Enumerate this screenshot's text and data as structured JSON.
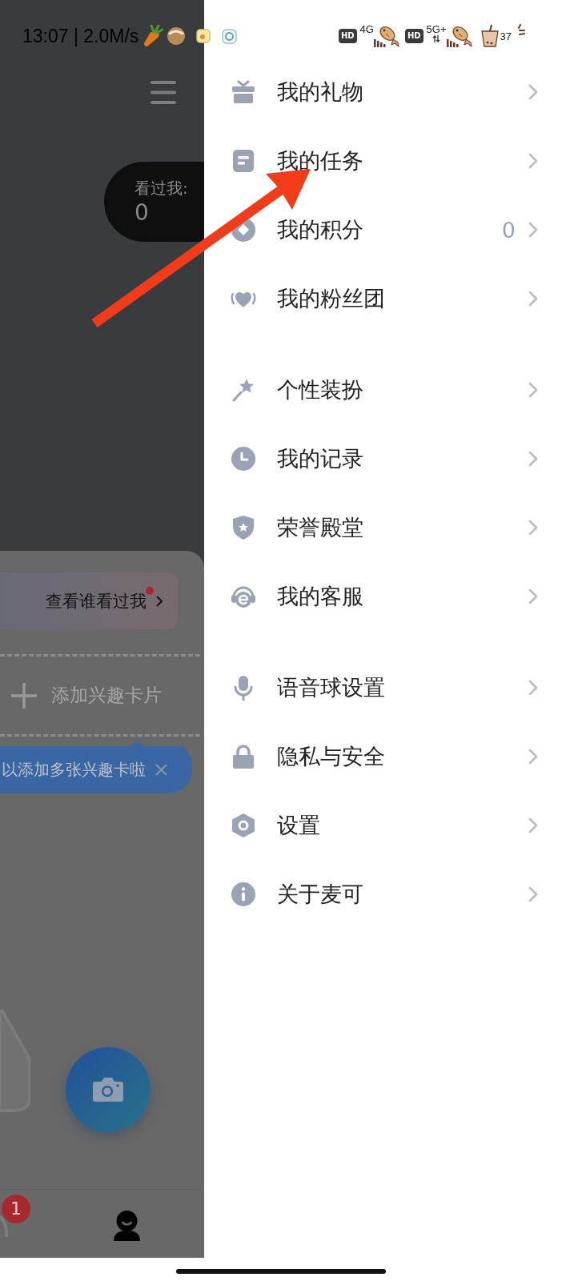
{
  "status_bar": {
    "time": "13:07 | 2.0M/s",
    "networks": [
      {
        "badge": "HD",
        "type": "4G",
        "data_arrows": false
      },
      {
        "badge": "HD",
        "type": "5G+",
        "data_arrows": true
      }
    ],
    "battery": "37"
  },
  "background_page": {
    "visitors": {
      "label": "看过我:",
      "count": "0"
    },
    "visitors_button": {
      "label": "查看谁看过我",
      "unread": true
    },
    "add_card": {
      "label": "添加兴趣卡片"
    },
    "tip": {
      "text": "以添加多张兴趣卡啦"
    },
    "bottom_nav": [
      {
        "badge": "1",
        "selected": false
      },
      {
        "selected": true
      }
    ]
  },
  "drawer": {
    "sections": [
      {
        "items": [
          {
            "label": "我的礼物"
          },
          {
            "label": "我的任务"
          },
          {
            "label": "我的积分",
            "value": "0"
          },
          {
            "label": "我的粉丝团"
          }
        ]
      },
      {
        "items": [
          {
            "label": "个性装扮"
          },
          {
            "label": "我的记录"
          },
          {
            "label": "荣誉殿堂"
          },
          {
            "label": "我的客服"
          }
        ]
      },
      {
        "items": [
          {
            "label": "语音球设置"
          },
          {
            "label": "隐私与安全"
          },
          {
            "label": "设置"
          },
          {
            "label": "关于麦可"
          }
        ]
      }
    ]
  }
}
